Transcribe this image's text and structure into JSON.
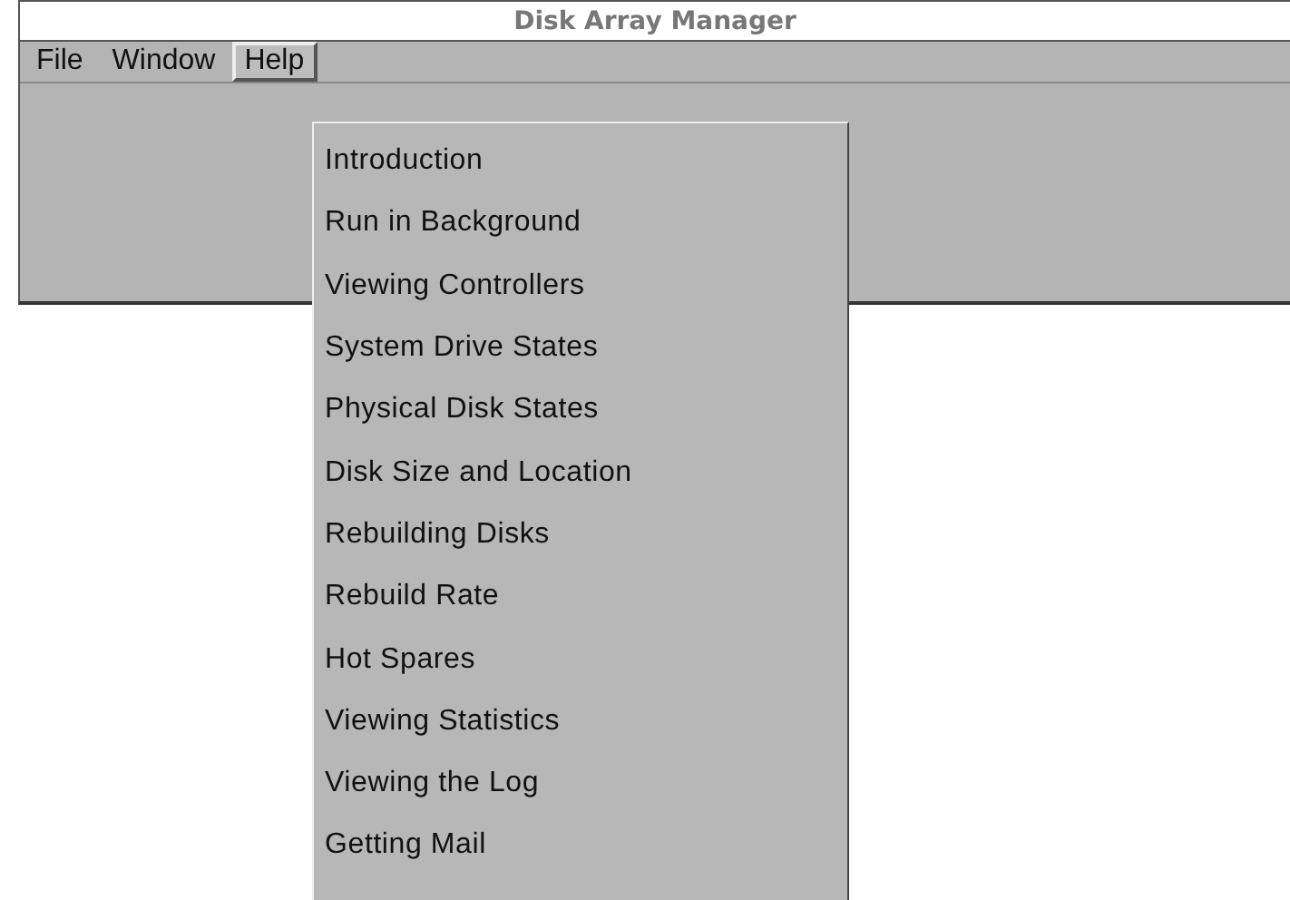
{
  "window": {
    "title": "Disk Array Manager"
  },
  "menubar": [
    {
      "label": "File",
      "selected": false
    },
    {
      "label": "Window",
      "selected": false
    },
    {
      "label": "Help",
      "selected": true
    }
  ],
  "help_menu": [
    {
      "label": "Introduction"
    },
    {
      "label": "Run in Background"
    },
    {
      "label": "Viewing Controllers"
    },
    {
      "label": "System Drive States"
    },
    {
      "label": "Physical Disk States"
    },
    {
      "label": "Disk Size and Location"
    },
    {
      "label": "Rebuilding Disks"
    },
    {
      "label": "Rebuild Rate"
    },
    {
      "label": "Hot Spares"
    },
    {
      "label": "Viewing Statistics"
    },
    {
      "label": "Viewing the Log"
    },
    {
      "label": "Getting Mail"
    }
  ]
}
